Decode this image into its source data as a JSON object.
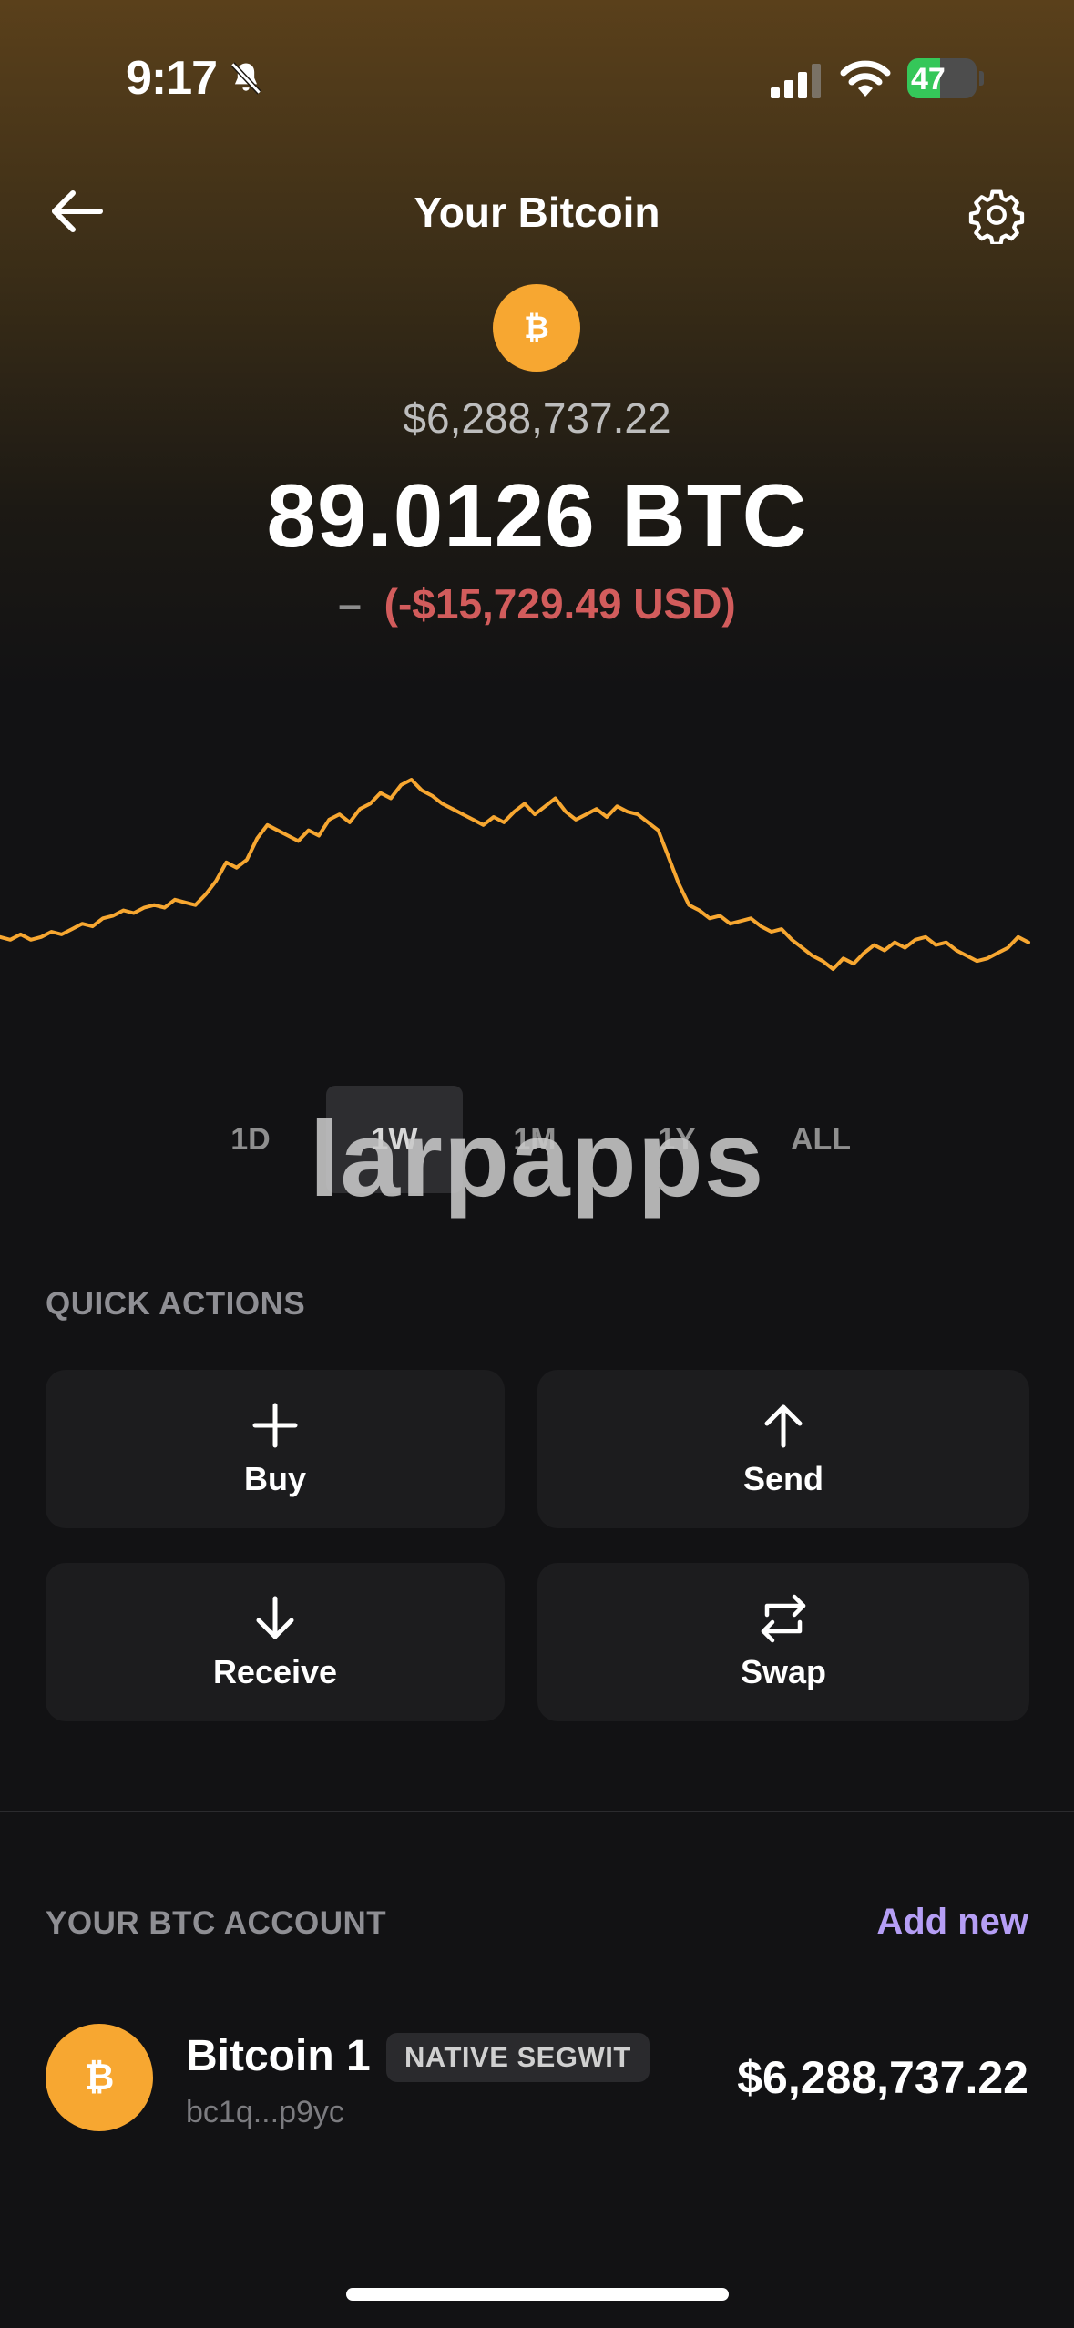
{
  "status_bar": {
    "time": "9:17",
    "battery": "47",
    "battery_level": 0.47
  },
  "header": {
    "title": "Your Bitcoin"
  },
  "balance": {
    "coin_symbol": "₿",
    "fiat": "$6,288,737.22",
    "crypto": "89.0126 BTC",
    "change_dash": "–",
    "change": "(-$15,729.49 USD)"
  },
  "chart_data": {
    "type": "line",
    "title": "",
    "xlabel": "",
    "ylabel": "",
    "grid": false,
    "legend": "none",
    "series_color": "#f7a731",
    "values": [
      42,
      41,
      43,
      41,
      42,
      44,
      43,
      45,
      47,
      46,
      49,
      50,
      52,
      51,
      53,
      54,
      53,
      56,
      55,
      54,
      58,
      63,
      70,
      68,
      71,
      79,
      84,
      82,
      80,
      78,
      82,
      80,
      86,
      88,
      85,
      90,
      92,
      96,
      94,
      99,
      101,
      97,
      95,
      92,
      90,
      88,
      86,
      84,
      87,
      85,
      89,
      92,
      88,
      91,
      94,
      89,
      86,
      88,
      90,
      87,
      91,
      89,
      88,
      85,
      82,
      72,
      62,
      54,
      52,
      49,
      50,
      47,
      48,
      49,
      46,
      44,
      45,
      41,
      38,
      35,
      33,
      30,
      34,
      32,
      36,
      39,
      37,
      40,
      38,
      41,
      42,
      39,
      40,
      37,
      35,
      33,
      34,
      36,
      38,
      42,
      40
    ]
  },
  "range_tabs": [
    {
      "label": "1D"
    },
    {
      "label": "1W"
    },
    {
      "label": "1M"
    },
    {
      "label": "1Y"
    },
    {
      "label": "ALL"
    }
  ],
  "watermark": "larpapps",
  "quick_actions": {
    "title": "QUICK ACTIONS",
    "buy": "Buy",
    "send": "Send",
    "receive": "Receive",
    "swap": "Swap"
  },
  "account_section": {
    "title": "YOUR BTC ACCOUNT",
    "add_new": "Add new"
  },
  "account": {
    "avatar_symbol": "₿",
    "name": "Bitcoin 1",
    "badge": "NATIVE SEGWIT",
    "address": "bc1q...p9yc",
    "value": "$6,288,737.22"
  }
}
